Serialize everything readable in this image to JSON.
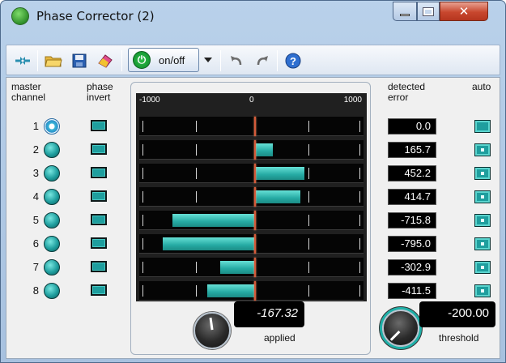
{
  "window": {
    "title": "Phase Corrector (2)"
  },
  "toolbar": {
    "onoff_label": "on/off"
  },
  "headers": {
    "master_channel": [
      "master",
      "channel"
    ],
    "phase_invert": [
      "phase",
      "invert"
    ],
    "detected_error": [
      "detected",
      "error"
    ],
    "auto": "auto"
  },
  "scale": {
    "min_label": "-1000",
    "center_label": "0",
    "max_label": "1000",
    "min": -1000,
    "max": 1000
  },
  "channels": [
    {
      "label": "1",
      "applied": 0,
      "error": "0.0",
      "master_selected": true
    },
    {
      "label": "2",
      "applied": 165.7,
      "error": "165.7",
      "master_selected": false
    },
    {
      "label": "3",
      "applied": 452.2,
      "error": "452.2",
      "master_selected": false
    },
    {
      "label": "4",
      "applied": 414.7,
      "error": "414.7",
      "master_selected": false
    },
    {
      "label": "5",
      "applied": -715.8,
      "error": "-715.8",
      "master_selected": false
    },
    {
      "label": "6",
      "applied": -795.0,
      "error": "-795.0",
      "master_selected": false
    },
    {
      "label": "7",
      "applied": -302.9,
      "error": "-302.9",
      "master_selected": false
    },
    {
      "label": "8",
      "applied": -411.5,
      "error": "-411.5",
      "master_selected": false
    }
  ],
  "applied": {
    "value": "-167.32",
    "label": "applied"
  },
  "threshold": {
    "value": "-200.00",
    "label": "threshold"
  },
  "colors": {
    "accent": "#1e9e9e",
    "meter_bg": "#050505",
    "center_line": "#d45a3a"
  }
}
